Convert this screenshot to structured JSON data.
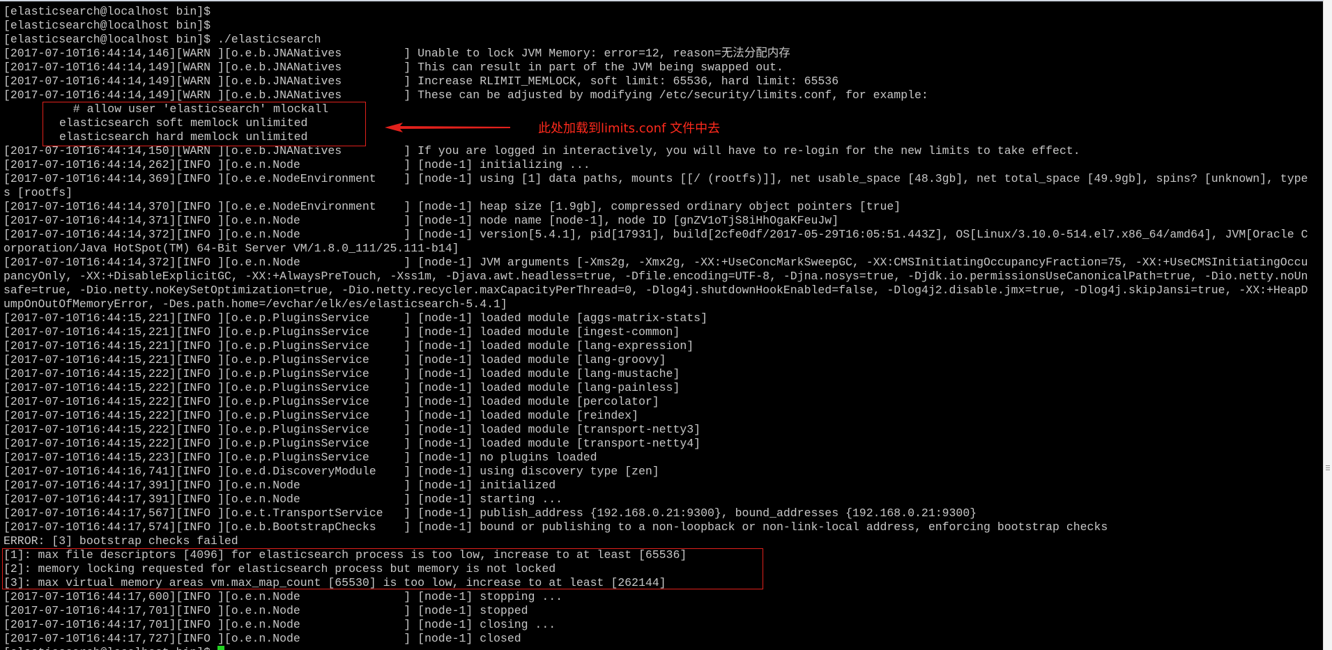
{
  "terminal": {
    "lines_top": [
      "[elasticsearch@localhost bin]$",
      "[elasticsearch@localhost bin]$",
      "[elasticsearch@localhost bin]$ ./elasticsearch",
      "[2017-07-10T16:44:14,146][WARN ][o.e.b.JNANatives         ] Unable to lock JVM Memory: error=12, reason=无法分配内存",
      "[2017-07-10T16:44:14,149][WARN ][o.e.b.JNANatives         ] This can result in part of the JVM being swapped out.",
      "[2017-07-10T16:44:14,149][WARN ][o.e.b.JNANatives         ] Increase RLIMIT_MEMLOCK, soft limit: 65536, hard limit: 65536",
      "[2017-07-10T16:44:14,149][WARN ][o.e.b.JNANatives         ] These can be adjusted by modifying /etc/security/limits.conf, for example:"
    ],
    "limits_lines": [
      "  # allow user 'elasticsearch' mlockall",
      "elasticsearch soft memlock unlimited",
      "elasticsearch hard memlock unlimited"
    ],
    "lines_mid": [
      "[2017-07-10T16:44:14,150][WARN ][o.e.b.JNANatives         ] If you are logged in interactively, you will have to re-login for the new limits to take effect.",
      "[2017-07-10T16:44:14,262][INFO ][o.e.n.Node               ] [node-1] initializing ...",
      "[2017-07-10T16:44:14,369][INFO ][o.e.e.NodeEnvironment    ] [node-1] using [1] data paths, mounts [[/ (rootfs)]], net usable_space [48.3gb], net total_space [49.9gb], spins? [unknown], type",
      "s [rootfs]",
      "[2017-07-10T16:44:14,370][INFO ][o.e.e.NodeEnvironment    ] [node-1] heap size [1.9gb], compressed ordinary object pointers [true]",
      "[2017-07-10T16:44:14,371][INFO ][o.e.n.Node               ] [node-1] node name [node-1], node ID [gnZV1oTjS8iHhOgaKFeuJw]",
      "[2017-07-10T16:44:14,372][INFO ][o.e.n.Node               ] [node-1] version[5.4.1], pid[17931], build[2cfe0df/2017-05-29T16:05:51.443Z], OS[Linux/3.10.0-514.el7.x86_64/amd64], JVM[Oracle C",
      "orporation/Java HotSpot(TM) 64-Bit Server VM/1.8.0_111/25.111-b14]",
      "[2017-07-10T16:44:14,372][INFO ][o.e.n.Node               ] [node-1] JVM arguments [-Xms2g, -Xmx2g, -XX:+UseConcMarkSweepGC, -XX:CMSInitiatingOccupancyFraction=75, -XX:+UseCMSInitiatingOccu",
      "pancyOnly, -XX:+DisableExplicitGC, -XX:+AlwaysPreTouch, -Xss1m, -Djava.awt.headless=true, -Dfile.encoding=UTF-8, -Djna.nosys=true, -Djdk.io.permissionsUseCanonicalPath=true, -Dio.netty.noUn",
      "safe=true, -Dio.netty.noKeySetOptimization=true, -Dio.netty.recycler.maxCapacityPerThread=0, -Dlog4j.shutdownHookEnabled=false, -Dlog4j2.disable.jmx=true, -Dlog4j.skipJansi=true, -XX:+HeapD",
      "umpOnOutOfMemoryError, -Des.path.home=/evchar/elk/es/elasticsearch-5.4.1]",
      "[2017-07-10T16:44:15,221][INFO ][o.e.p.PluginsService     ] [node-1] loaded module [aggs-matrix-stats]",
      "[2017-07-10T16:44:15,221][INFO ][o.e.p.PluginsService     ] [node-1] loaded module [ingest-common]",
      "[2017-07-10T16:44:15,221][INFO ][o.e.p.PluginsService     ] [node-1] loaded module [lang-expression]",
      "[2017-07-10T16:44:15,221][INFO ][o.e.p.PluginsService     ] [node-1] loaded module [lang-groovy]",
      "[2017-07-10T16:44:15,222][INFO ][o.e.p.PluginsService     ] [node-1] loaded module [lang-mustache]",
      "[2017-07-10T16:44:15,222][INFO ][o.e.p.PluginsService     ] [node-1] loaded module [lang-painless]",
      "[2017-07-10T16:44:15,222][INFO ][o.e.p.PluginsService     ] [node-1] loaded module [percolator]",
      "[2017-07-10T16:44:15,222][INFO ][o.e.p.PluginsService     ] [node-1] loaded module [reindex]",
      "[2017-07-10T16:44:15,222][INFO ][o.e.p.PluginsService     ] [node-1] loaded module [transport-netty3]",
      "[2017-07-10T16:44:15,222][INFO ][o.e.p.PluginsService     ] [node-1] loaded module [transport-netty4]",
      "[2017-07-10T16:44:15,223][INFO ][o.e.p.PluginsService     ] [node-1] no plugins loaded",
      "[2017-07-10T16:44:16,741][INFO ][o.e.d.DiscoveryModule    ] [node-1] using discovery type [zen]",
      "[2017-07-10T16:44:17,391][INFO ][o.e.n.Node               ] [node-1] initialized",
      "[2017-07-10T16:44:17,391][INFO ][o.e.n.Node               ] [node-1] starting ...",
      "[2017-07-10T16:44:17,567][INFO ][o.e.t.TransportService   ] [node-1] publish_address {192.168.0.21:9300}, bound_addresses {192.168.0.21:9300}",
      "[2017-07-10T16:44:17,574][INFO ][o.e.b.BootstrapChecks    ] [node-1] bound or publishing to a non-loopback or non-link-local address, enforcing bootstrap checks",
      "ERROR: [3] bootstrap checks failed"
    ],
    "error_lines": [
      "[1]: max file descriptors [4096] for elasticsearch process is too low, increase to at least [65536]",
      "[2]: memory locking requested for elasticsearch process but memory is not locked",
      "[3]: max virtual memory areas vm.max_map_count [65530] is too low, increase to at least [262144]"
    ],
    "lines_bottom": [
      "[2017-07-10T16:44:17,600][INFO ][o.e.n.Node               ] [node-1] stopping ...",
      "[2017-07-10T16:44:17,701][INFO ][o.e.n.Node               ] [node-1] stopped",
      "[2017-07-10T16:44:17,701][INFO ][o.e.n.Node               ] [node-1] closing ...",
      "[2017-07-10T16:44:17,727][INFO ][o.e.n.Node               ] [node-1] closed"
    ],
    "prompt": "[elasticsearch@localhost bin]$ "
  },
  "annotation": {
    "text": "此处加载到limits.conf 文件中去"
  },
  "colors": {
    "background": "#000000",
    "text": "#c7c7c7",
    "annotation": "#ff2a1d",
    "cursor": "#22d122"
  }
}
